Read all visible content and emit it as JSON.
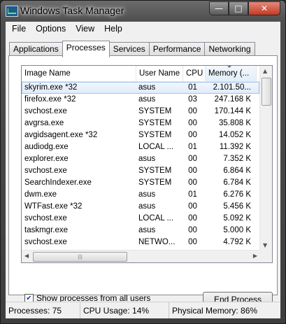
{
  "window": {
    "title": "Windows Task Manager",
    "min_glyph": "—",
    "max_glyph": "□",
    "close_glyph": "✕"
  },
  "menu": [
    "File",
    "Options",
    "View",
    "Help"
  ],
  "tabs": [
    "Applications",
    "Processes",
    "Services",
    "Performance",
    "Networking"
  ],
  "active_tab": "Processes",
  "columns": {
    "image": "Image Name",
    "user": "User Name",
    "cpu": "CPU",
    "memory": "Memory (..."
  },
  "processes": [
    {
      "name": "skyrim.exe *32",
      "user": "asus",
      "cpu": "01",
      "mem": "2.101.50..."
    },
    {
      "name": "firefox.exe *32",
      "user": "asus",
      "cpu": "03",
      "mem": "247.168 K"
    },
    {
      "name": "svchost.exe",
      "user": "SYSTEM",
      "cpu": "00",
      "mem": "170.144 K"
    },
    {
      "name": "avgrsa.exe",
      "user": "SYSTEM",
      "cpu": "00",
      "mem": "35.808 K"
    },
    {
      "name": "avgidsagent.exe *32",
      "user": "SYSTEM",
      "cpu": "00",
      "mem": "14.052 K"
    },
    {
      "name": "audiodg.exe",
      "user": "LOCAL ...",
      "cpu": "01",
      "mem": "11.392 K"
    },
    {
      "name": "explorer.exe",
      "user": "asus",
      "cpu": "00",
      "mem": "7.352 K"
    },
    {
      "name": "svchost.exe",
      "user": "SYSTEM",
      "cpu": "00",
      "mem": "6.864 K"
    },
    {
      "name": "SearchIndexer.exe",
      "user": "SYSTEM",
      "cpu": "00",
      "mem": "6.784 K"
    },
    {
      "name": "dwm.exe",
      "user": "asus",
      "cpu": "01",
      "mem": "6.276 K"
    },
    {
      "name": "WTFast.exe *32",
      "user": "asus",
      "cpu": "00",
      "mem": "5.456 K"
    },
    {
      "name": "svchost.exe",
      "user": "LOCAL ...",
      "cpu": "00",
      "mem": "5.092 K"
    },
    {
      "name": "taskmgr.exe",
      "user": "asus",
      "cpu": "00",
      "mem": "5.000 K"
    },
    {
      "name": "svchost.exe",
      "user": "NETWO...",
      "cpu": "00",
      "mem": "4.792 K"
    }
  ],
  "selected_index": 0,
  "show_all": {
    "label": "Show processes from all users",
    "checked": true
  },
  "end_process_label": "End Process",
  "status": {
    "processes": "Processes: 75",
    "cpu": "CPU Usage: 14%",
    "memory": "Physical Memory: 86%"
  },
  "colors": {
    "selection": "#dfebf9",
    "close_button": "#c43b24"
  }
}
